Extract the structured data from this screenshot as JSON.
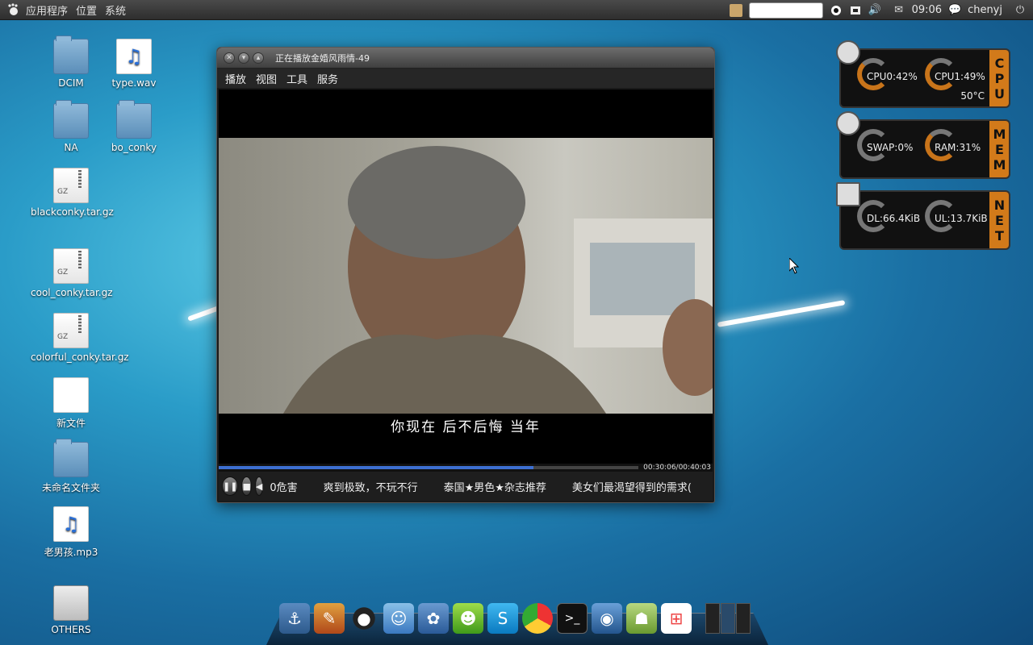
{
  "top_panel": {
    "menus": [
      "应用程序",
      "位置",
      "系统"
    ],
    "clock": "09:06",
    "user": "chenyj"
  },
  "desktop_icons": [
    {
      "label": "DCIM",
      "type": "folder"
    },
    {
      "label": "type.wav",
      "type": "audio"
    },
    {
      "label": "NA",
      "type": "folder"
    },
    {
      "label": "bo_conky",
      "type": "folder"
    },
    {
      "label": "blackconky.tar.gz",
      "type": "gz"
    },
    {
      "label": "cool_conky.tar.gz",
      "type": "gz"
    },
    {
      "label": "colorful_conky.tar.gz",
      "type": "gz"
    },
    {
      "label": "新文件",
      "type": "doc"
    },
    {
      "label": "未命名文件夹",
      "type": "folder"
    },
    {
      "label": "老男孩.mp3",
      "type": "mp3"
    },
    {
      "label": "OTHERS",
      "type": "drive"
    }
  ],
  "player": {
    "title": "正在播放金婚风雨情-49",
    "menu": [
      "播放",
      "视图",
      "工具",
      "服务"
    ],
    "subtitle": "你现在 后不后悔 当年",
    "time": "00:30:06/00:40:03",
    "progress": 0.75,
    "ticker": [
      "0危害",
      "爽到极致，不玩不行",
      "泰国★男色★杂志推荐",
      "美女们最渴望得到的需求("
    ]
  },
  "conky": {
    "cpu": {
      "side": "CPU",
      "cpu0": "CPU0:42%",
      "cpu1": "CPU1:49%",
      "temp": "50°C"
    },
    "mem": {
      "side": "MEM",
      "swap": "SWAP:0%",
      "ram": "RAM:31%"
    },
    "net": {
      "side": "NET",
      "dl": "DL:66.4KiB",
      "ul": "UL:13.7KiB"
    }
  },
  "dock": [
    "anchor-icon",
    "paint-icon",
    "qq-icon",
    "msn-icon",
    "paw-icon",
    "fetion-icon",
    "skype-icon",
    "chrome-icon",
    "terminal-icon",
    "network-icon",
    "android-icon",
    "windows-icon"
  ],
  "colors": {
    "accent_orange": "#d27a1a",
    "progress_blue": "#3d6fd1"
  }
}
